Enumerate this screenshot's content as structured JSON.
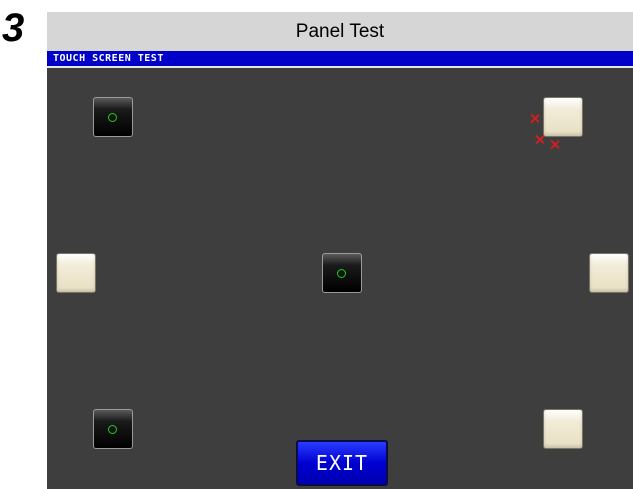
{
  "step_number": "3",
  "title": "Panel Test",
  "header": {
    "label": "TOUCH SCREEN TEST"
  },
  "targets": [
    {
      "id": "top-left",
      "state": "touched"
    },
    {
      "id": "top-right",
      "state": "untouched"
    },
    {
      "id": "middle-left",
      "state": "untouched"
    },
    {
      "id": "center",
      "state": "touched"
    },
    {
      "id": "middle-right",
      "state": "untouched"
    },
    {
      "id": "bottom-left",
      "state": "touched"
    },
    {
      "id": "bottom-right",
      "state": "untouched"
    }
  ],
  "miss_marks": {
    "count": 3,
    "color": "#d02020"
  },
  "ok_mark_color": "#19d219",
  "exit": {
    "label": "EXIT"
  },
  "colors": {
    "screen_bg": "#3e3e3e",
    "header_bg": "#0000c8",
    "exit_bg": "#0000d0",
    "title_bar_bg": "#d6d6d6"
  }
}
